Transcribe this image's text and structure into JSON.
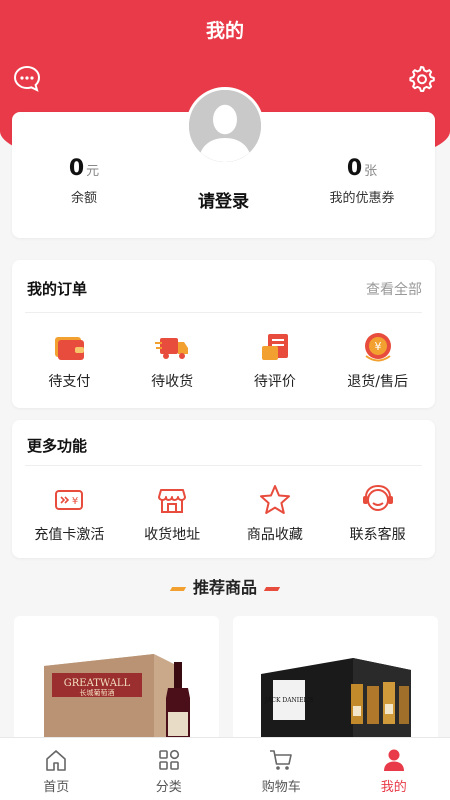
{
  "header": {
    "title": "我的"
  },
  "user": {
    "login_text": "请登录",
    "balance": {
      "value": "0",
      "unit": "元",
      "label": "余额"
    },
    "coupons": {
      "value": "0",
      "unit": "张",
      "label": "我的优惠券"
    }
  },
  "orders": {
    "title": "我的订单",
    "view_all": "查看全部",
    "items": [
      {
        "label": "待支付",
        "icon": "wallet-icon"
      },
      {
        "label": "待收货",
        "icon": "truck-icon"
      },
      {
        "label": "待评价",
        "icon": "review-icon"
      },
      {
        "label": "退货/售后",
        "icon": "refund-icon"
      }
    ]
  },
  "features": {
    "title": "更多功能",
    "items": [
      {
        "label": "充值卡激活",
        "icon": "recharge-card-icon"
      },
      {
        "label": "收货地址",
        "icon": "store-address-icon"
      },
      {
        "label": "商品收藏",
        "icon": "star-icon"
      },
      {
        "label": "联系客服",
        "icon": "customer-service-icon"
      }
    ]
  },
  "recommend": {
    "title": "推荐商品",
    "products": [
      {
        "name": "greatwall-wine",
        "box_text": "GREATWALL",
        "box_sub": "长城葡萄酒"
      },
      {
        "name": "jack-daniels-whiskey-set",
        "box_text": "JACK DANIEL'S"
      }
    ]
  },
  "tabbar": {
    "items": [
      {
        "label": "首页",
        "icon": "home-icon"
      },
      {
        "label": "分类",
        "icon": "category-icon"
      },
      {
        "label": "购物车",
        "icon": "cart-icon"
      },
      {
        "label": "我的",
        "icon": "user-icon",
        "active": true
      }
    ]
  },
  "colors": {
    "accent": "#e83a48",
    "icon_orange": "#f2a130",
    "icon_red": "#e84c3d"
  }
}
